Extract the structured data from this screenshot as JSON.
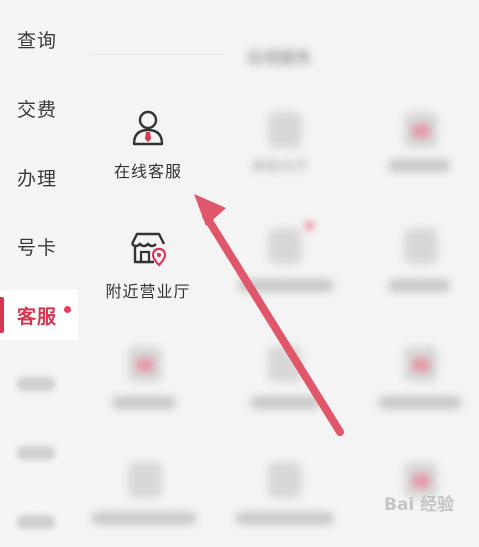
{
  "sidebar": {
    "items": [
      {
        "label": "查询"
      },
      {
        "label": "交费"
      },
      {
        "label": "办理"
      },
      {
        "label": "号卡"
      },
      {
        "label": "客服"
      }
    ]
  },
  "main": {
    "tiles": [
      {
        "label": "在线客服"
      },
      {
        "label": "附近营业厅"
      }
    ]
  },
  "blurred": {
    "section_title": "在线服务",
    "tile_labels": [
      "体验大厅"
    ]
  },
  "watermark": {
    "text": "Bai 经验"
  },
  "colors": {
    "accent": "#d6364f",
    "arrow": "#e0566a"
  }
}
